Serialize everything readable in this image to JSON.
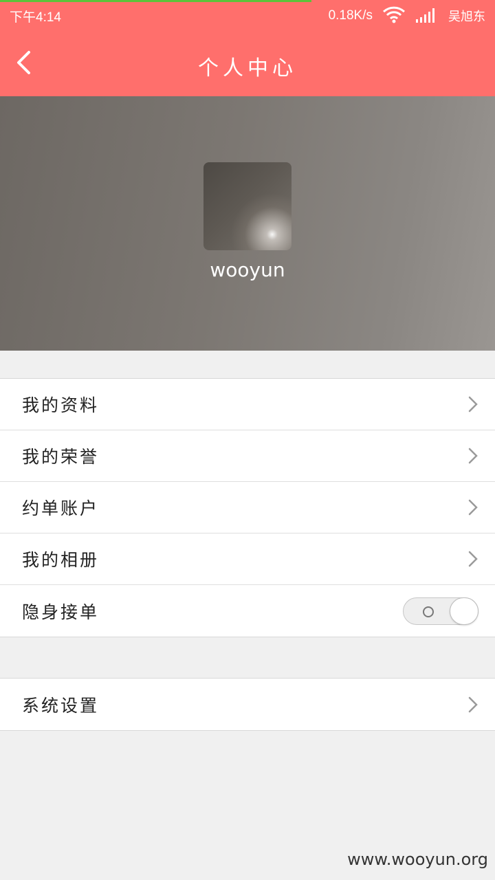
{
  "status_bar": {
    "time": "下午4:14",
    "network_speed": "0.18K/s",
    "carrier": "吴旭东",
    "icons": [
      "wifi-icon",
      "signal-icon"
    ]
  },
  "header": {
    "title": "个人中心",
    "back_icon": "chevron-left-icon"
  },
  "profile": {
    "username": "wooyun"
  },
  "menu": {
    "items": [
      {
        "label": "我的资料"
      },
      {
        "label": "我的荣誉"
      },
      {
        "label": "约单账户"
      },
      {
        "label": "我的相册"
      },
      {
        "label": "隐身接单",
        "toggle": false
      }
    ],
    "settings": {
      "label": "系统设置"
    }
  },
  "watermark": "www.wooyun.org",
  "colors": {
    "header": "#ff6f6c",
    "background": "#f0f0f0",
    "load_bar": "#5cc33a"
  }
}
